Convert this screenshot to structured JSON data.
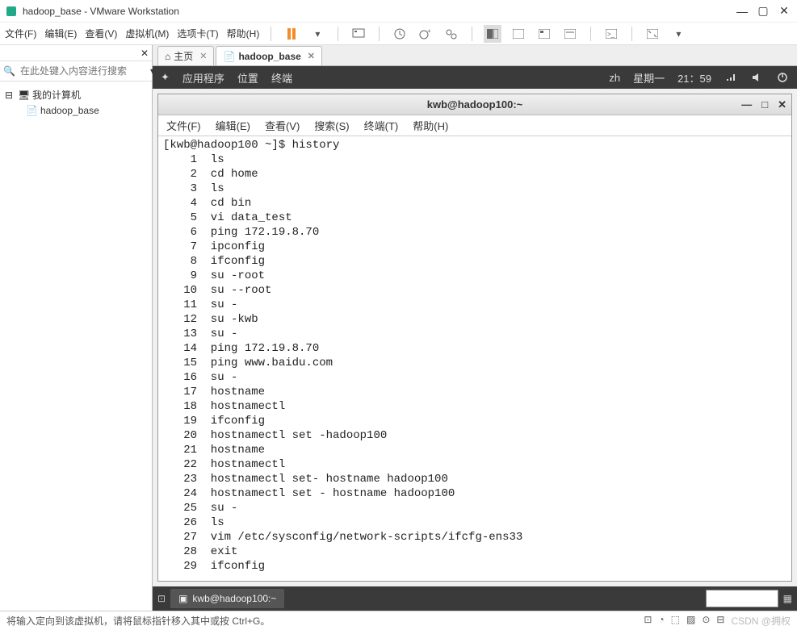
{
  "window": {
    "title": "hadoop_base - VMware Workstation"
  },
  "menubar": {
    "items": [
      "文件(F)",
      "编辑(E)",
      "查看(V)",
      "虚拟机(M)",
      "选项卡(T)",
      "帮助(H)"
    ]
  },
  "sidebar": {
    "search_placeholder": "在此处键入内容进行搜索",
    "root": "我的计算机",
    "vm": "hadoop_base"
  },
  "tabs": {
    "home": "主页",
    "vm": "hadoop_base"
  },
  "desktop_bar": {
    "apps": "应用程序",
    "places": "位置",
    "terminal": "终端",
    "lang": "zh",
    "date": "星期一",
    "time": "21：59"
  },
  "terminal": {
    "title": "kwb@hadoop100:~",
    "menu": {
      "file": "文件(F)",
      "edit": "编辑(E)",
      "view": "查看(V)",
      "search": "搜索(S)",
      "terminal": "终端(T)",
      "help": "帮助(H)"
    },
    "prompt": "[kwb@hadoop100 ~]$ history",
    "history": [
      {
        "n": "1",
        "c": "ls"
      },
      {
        "n": "2",
        "c": "cd home"
      },
      {
        "n": "3",
        "c": "ls"
      },
      {
        "n": "4",
        "c": "cd bin"
      },
      {
        "n": "5",
        "c": "vi data_test"
      },
      {
        "n": "6",
        "c": "ping 172.19.8.70"
      },
      {
        "n": "7",
        "c": "ipconfig"
      },
      {
        "n": "8",
        "c": "ifconfig"
      },
      {
        "n": "9",
        "c": "su -root"
      },
      {
        "n": "10",
        "c": "su --root"
      },
      {
        "n": "11",
        "c": "su -"
      },
      {
        "n": "12",
        "c": "su -kwb"
      },
      {
        "n": "13",
        "c": "su -"
      },
      {
        "n": "14",
        "c": "ping 172.19.8.70"
      },
      {
        "n": "15",
        "c": "ping www.baidu.com"
      },
      {
        "n": "16",
        "c": "su -"
      },
      {
        "n": "17",
        "c": "hostname"
      },
      {
        "n": "18",
        "c": "hostnamectl"
      },
      {
        "n": "19",
        "c": "ifconfig"
      },
      {
        "n": "20",
        "c": "hostnamectl set -hadoop100"
      },
      {
        "n": "21",
        "c": "hostname"
      },
      {
        "n": "22",
        "c": "hostnamectl"
      },
      {
        "n": "23",
        "c": "hostnamectl set- hostname hadoop100"
      },
      {
        "n": "24",
        "c": "hostnamectl set - hostname hadoop100"
      },
      {
        "n": "25",
        "c": "su -"
      },
      {
        "n": "26",
        "c": "ls"
      },
      {
        "n": "27",
        "c": "vim /etc/sysconfig/network-scripts/ifcfg-ens33"
      },
      {
        "n": "28",
        "c": "exit"
      },
      {
        "n": "29",
        "c": "ifconfig"
      }
    ]
  },
  "taskbar": {
    "term": "kwb@hadoop100:~"
  },
  "status": {
    "text": "将输入定向到该虚拟机，请将鼠标指针移入其中或按 Ctrl+G。"
  },
  "watermark": "CSDN @拥权"
}
